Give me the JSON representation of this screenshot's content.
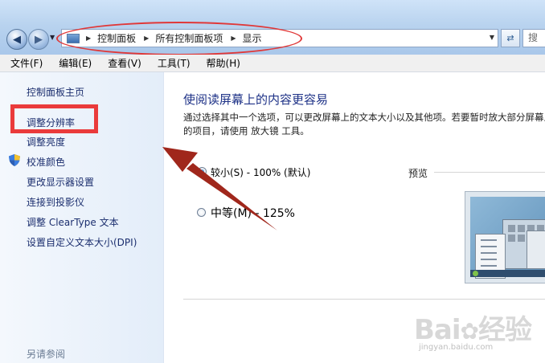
{
  "window": {
    "breadcrumbs": [
      "控制面板",
      "所有控制面板项",
      "显示"
    ],
    "search_placeholder": "搜"
  },
  "menu": [
    "文件(F)",
    "编辑(E)",
    "查看(V)",
    "工具(T)",
    "帮助(H)"
  ],
  "sidebar": {
    "home": "控制面板主页",
    "items": [
      "调整分辨率",
      "调整亮度",
      "校准颜色",
      "更改显示器设置",
      "连接到投影仪",
      "调整 ClearType 文本",
      "设置自定义文本大小(DPI)"
    ],
    "see_also": "另请参阅"
  },
  "main": {
    "title": "使阅读屏幕上的内容更容易",
    "description": "通过选择其中一个选项，可以更改屏幕上的文本大小以及其他项。若要暂时放大部分屏幕上的项目，请使用 放大镜 工具。",
    "options": [
      {
        "label": "较小(S) - 100% (默认)",
        "checked": true
      },
      {
        "label": "中等(M) - 125%",
        "checked": false
      }
    ],
    "preview_label": "预览"
  },
  "watermark": {
    "logo_text": "Bai du 经验",
    "url": "jingyan.baidu.com"
  },
  "colors": {
    "highlight_red": "#ea3b3b",
    "link_blue": "#1b2e6e",
    "title_blue": "#1e3287"
  }
}
